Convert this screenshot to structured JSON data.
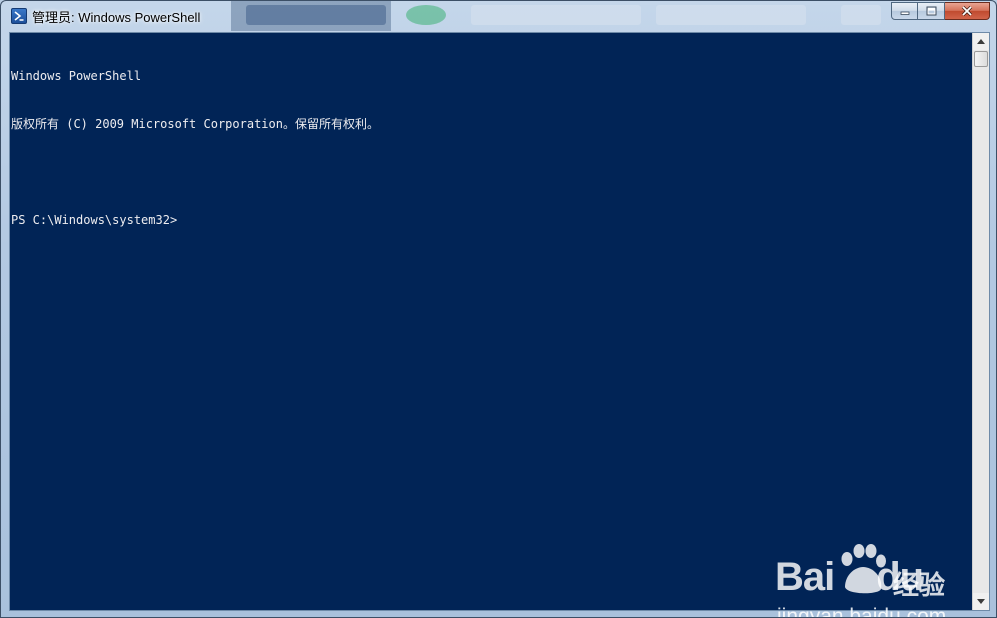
{
  "window": {
    "title": "管理员: Windows PowerShell",
    "app_icon": "powershell-icon",
    "buttons": {
      "minimize_icon": "minimize-icon",
      "maximize_icon": "maximize-icon",
      "close_icon": "close-icon"
    }
  },
  "console": {
    "background_color": "#012456",
    "text_color": "#eeedf0",
    "lines": [
      "Windows PowerShell",
      "版权所有 (C) 2009 Microsoft Corporation。保留所有权利。",
      "",
      "PS C:\\Windows\\system32>"
    ]
  },
  "scrollbar": {
    "up_icon": "scroll-up-arrow-icon",
    "down_icon": "scroll-down-arrow-icon"
  },
  "watermark": {
    "logo_text_left": "Bai",
    "logo_text_right": "du",
    "logo_cn": "经验",
    "url": "jingyan.baidu.com"
  }
}
